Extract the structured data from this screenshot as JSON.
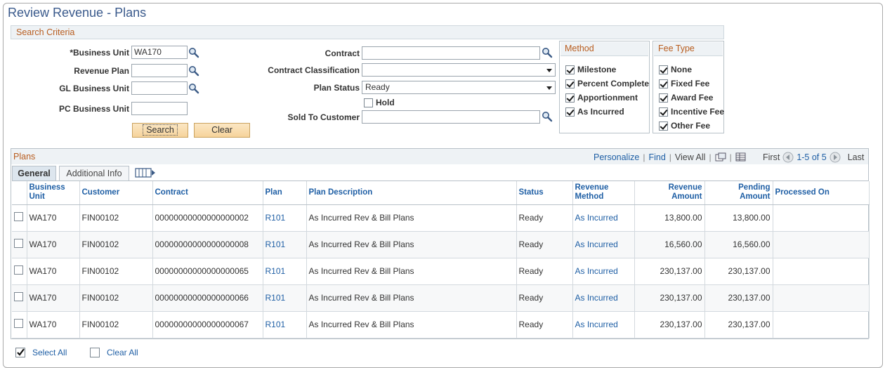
{
  "page": {
    "title": "Review Revenue - Plans"
  },
  "search_criteria": {
    "header": "Search Criteria",
    "business_unit": {
      "label": "*Business Unit",
      "value": "WA170"
    },
    "revenue_plan": {
      "label": "Revenue Plan",
      "value": ""
    },
    "gl_business_unit": {
      "label": "GL Business Unit",
      "value": ""
    },
    "pc_business_unit": {
      "label": "PC Business Unit",
      "value": ""
    },
    "contract": {
      "label": "Contract",
      "value": ""
    },
    "contract_classification": {
      "label": "Contract Classification",
      "value": ""
    },
    "plan_status": {
      "label": "Plan Status",
      "value": "Ready"
    },
    "hold": {
      "label": "Hold",
      "checked": false
    },
    "sold_to_customer": {
      "label": "Sold To Customer",
      "value": ""
    },
    "search_label": "Search",
    "clear_label": "Clear"
  },
  "method": {
    "header": "Method",
    "items": [
      {
        "label": "Milestone",
        "checked": true
      },
      {
        "label": "Percent Complete",
        "checked": true
      },
      {
        "label": "Apportionment",
        "checked": true
      },
      {
        "label": "As Incurred",
        "checked": true
      }
    ]
  },
  "fee_type": {
    "header": "Fee Type",
    "items": [
      {
        "label": "None",
        "checked": true
      },
      {
        "label": "Fixed Fee",
        "checked": true
      },
      {
        "label": "Award Fee",
        "checked": true
      },
      {
        "label": "Incentive Fee",
        "checked": true
      },
      {
        "label": "Other Fee",
        "checked": true
      }
    ]
  },
  "plans": {
    "title": "Plans",
    "personalize": "Personalize",
    "find": "Find",
    "view_all": "View All",
    "first": "First",
    "range": "1-5 of 5",
    "last": "Last",
    "tabs": [
      {
        "label": "General",
        "active": true
      },
      {
        "label": "Additional Info",
        "active": false
      }
    ],
    "columns": [
      "Business Unit",
      "Customer",
      "Contract",
      "Plan",
      "Plan Description",
      "Status",
      "Revenue Method",
      "Revenue Amount",
      "Pending Amount",
      "Processed On"
    ],
    "rows": [
      {
        "bu": "WA170",
        "customer": "FIN00102",
        "contract": "00000000000000000002",
        "plan": "R101",
        "desc": "As Incurred Rev & Bill Plans",
        "status": "Ready",
        "method": "As Incurred",
        "revenue": "13,800.00",
        "pending": "13,800.00",
        "processed": ""
      },
      {
        "bu": "WA170",
        "customer": "FIN00102",
        "contract": "00000000000000000008",
        "plan": "R101",
        "desc": "As Incurred Rev & Bill Plans",
        "status": "Ready",
        "method": "As Incurred",
        "revenue": "16,560.00",
        "pending": "16,560.00",
        "processed": ""
      },
      {
        "bu": "WA170",
        "customer": "FIN00102",
        "contract": "00000000000000000065",
        "plan": "R101",
        "desc": "As Incurred Rev & Bill Plans",
        "status": "Ready",
        "method": "As Incurred",
        "revenue": "230,137.00",
        "pending": "230,137.00",
        "processed": ""
      },
      {
        "bu": "WA170",
        "customer": "FIN00102",
        "contract": "00000000000000000066",
        "plan": "R101",
        "desc": "As Incurred Rev & Bill Plans",
        "status": "Ready",
        "method": "As Incurred",
        "revenue": "230,137.00",
        "pending": "230,137.00",
        "processed": ""
      },
      {
        "bu": "WA170",
        "customer": "FIN00102",
        "contract": "00000000000000000067",
        "plan": "R101",
        "desc": "As Incurred Rev & Bill Plans",
        "status": "Ready",
        "method": "As Incurred",
        "revenue": "230,137.00",
        "pending": "230,137.00",
        "processed": ""
      }
    ]
  },
  "footer": {
    "select_all": "Select All",
    "clear_all": "Clear All"
  },
  "colors": {
    "title": "#3a5a8c",
    "section_header": "#b85d1f",
    "link": "#1f5fa5",
    "button": "#f6d39b"
  }
}
